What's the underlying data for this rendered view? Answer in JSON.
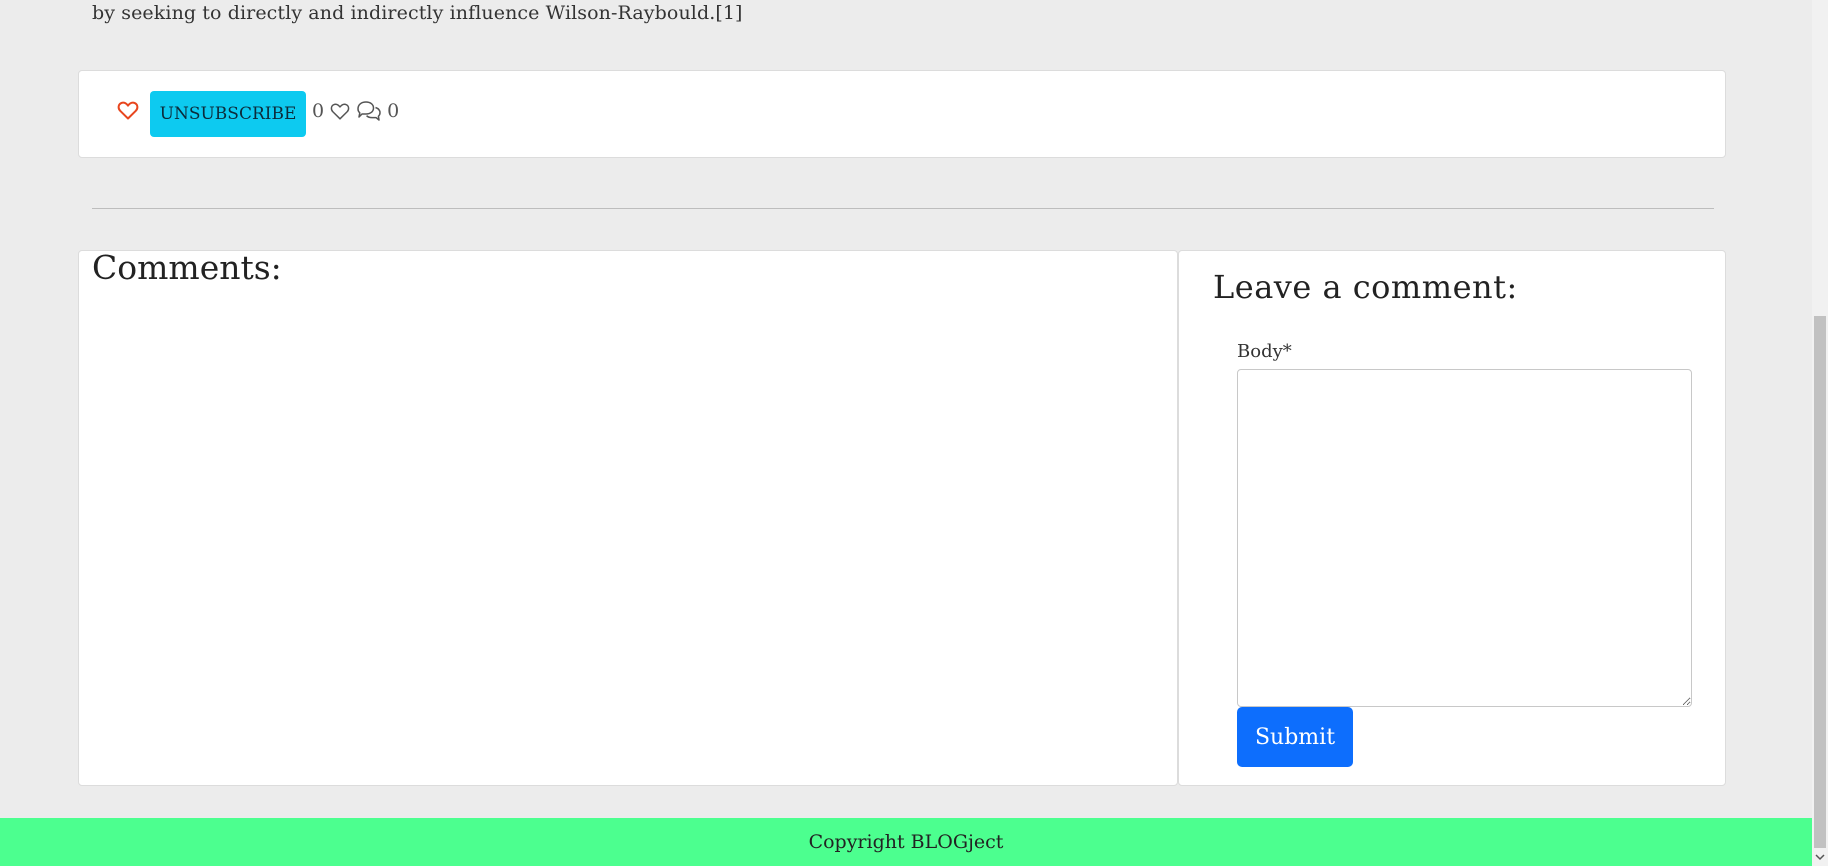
{
  "article": {
    "body_tail": "by seeking to directly and indirectly influence Wilson-Raybould.[1]"
  },
  "actions": {
    "like_icon": "heart-outline-icon",
    "unsubscribe_label": "UNSUBSCRIBE",
    "likes_count": "0",
    "comments_count": "0"
  },
  "comments": {
    "title": "Comments:"
  },
  "comment_form": {
    "title": "Leave a comment:",
    "body_label": "Body*",
    "body_value": "",
    "submit_label": "Submit"
  },
  "footer": {
    "text": "Copyright BLOGject"
  },
  "colors": {
    "page_bg": "#ececec",
    "unsubscribe_bg": "#0dcaf0",
    "submit_bg": "#0d6efd",
    "footer_bg": "#4cff8f",
    "like_icon": "#e8461e"
  }
}
